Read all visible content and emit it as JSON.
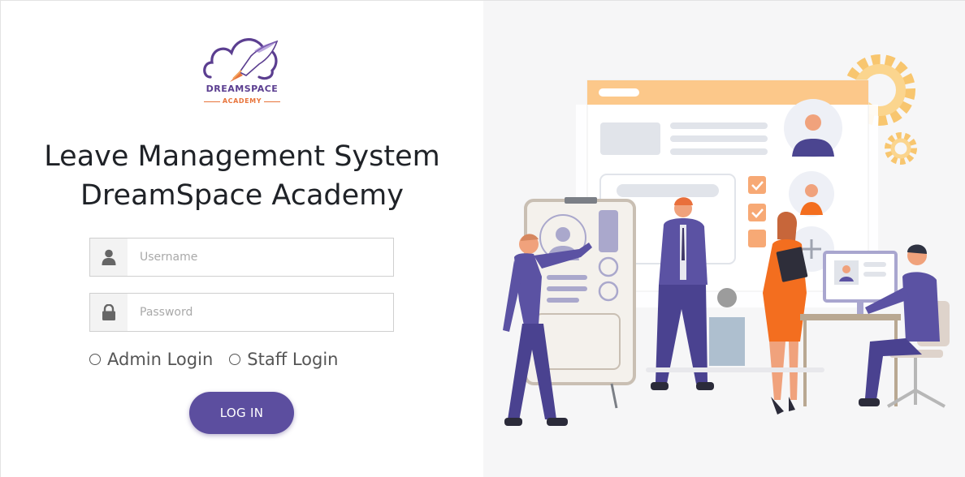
{
  "logo": {
    "line1": "DREAMSPACE",
    "line2": "ACADEMY"
  },
  "title": {
    "line1": "Leave Management System",
    "line2": "DreamSpace Academy"
  },
  "form": {
    "username_placeholder": "Username",
    "password_placeholder": "Password",
    "username_value": "",
    "password_value": "",
    "options": [
      {
        "label": "Admin Login",
        "selected": false
      },
      {
        "label": "Staff Login",
        "selected": false
      }
    ],
    "submit_label": "LOG IN"
  },
  "colors": {
    "accent": "#5c4e9f",
    "logo_purple": "#5b3e90",
    "logo_orange": "#e8743b",
    "illustration_bg": "#f6f6f7"
  },
  "icons": {
    "username": "user-icon",
    "password": "lock-icon"
  }
}
